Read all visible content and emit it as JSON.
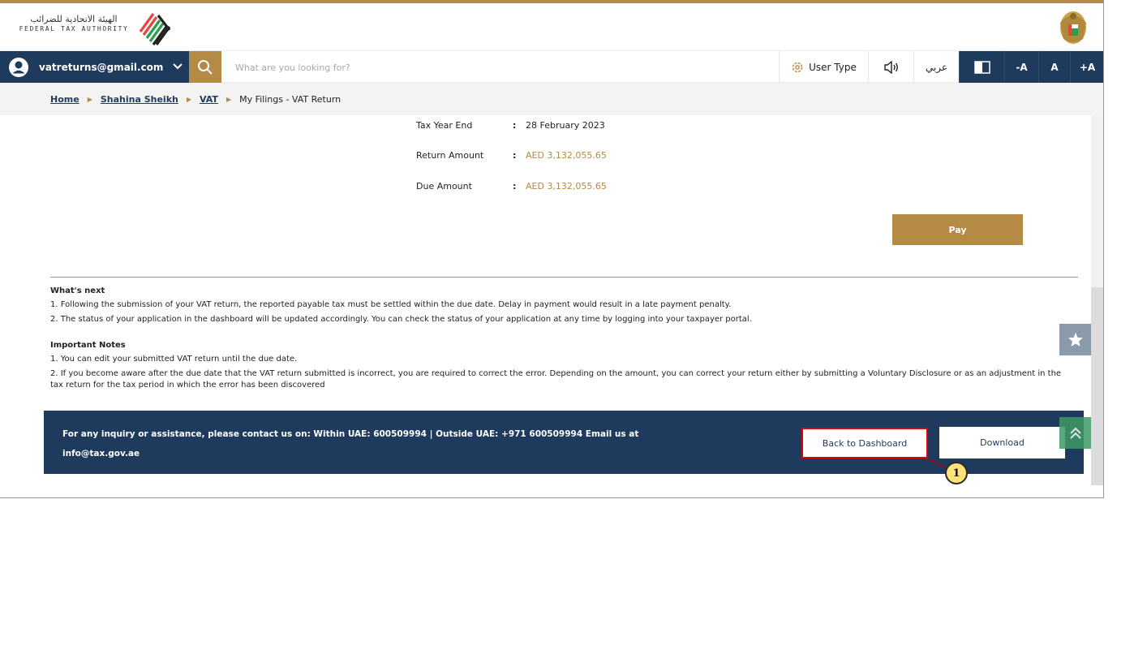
{
  "header": {
    "logo_ar": "الهيئة الاتحادية للضرائب",
    "logo_en": "FEDERAL TAX AUTHORITY"
  },
  "nav": {
    "user_email": "vatreturns@gmail.com",
    "search_placeholder": "What are you looking for?",
    "user_type_label": "User Type",
    "arabic_label": "عربي",
    "font_decrease": "-A",
    "font_normal": "A",
    "font_increase": "+A"
  },
  "breadcrumb": {
    "items": [
      "Home",
      "Shahina Sheikh",
      "VAT"
    ],
    "current": "My Filings - VAT Return"
  },
  "summary": {
    "rows": [
      {
        "label": "Tax Year End",
        "value": "28 February 2023"
      },
      {
        "label": "Return Amount",
        "value": "AED 3,132,055.65"
      },
      {
        "label": "Due Amount",
        "value": "AED 3,132,055.65"
      }
    ],
    "separator": ":",
    "amount_color": "#b48a45"
  },
  "pay_label": "Pay",
  "whats_next": {
    "title": "What's next",
    "items": [
      "1. Following the submission of your VAT return, the reported payable tax must be settled within the due date. Delay in payment would result in a late payment penalty.",
      "2. The status of your application in the dashboard will be updated accordingly. You can check the status of your application at any time by logging into your taxpayer portal."
    ]
  },
  "important_notes": {
    "title": "Important Notes",
    "items": [
      "1. You can edit your submitted VAT return until the due date.",
      "2. If you become aware after the due date that the VAT return submitted is incorrect, you are required to correct the error. Depending on the amount, you can correct your return either by submitting a Voluntary Disclosure or as an adjustment in the tax return for the tax period in which the error has been discovered"
    ]
  },
  "footer": {
    "contact_line1": "For any inquiry or assistance, please contact us on: Within UAE: 600509994 | Outside UAE: +971 600509994 Email us at",
    "contact_line2": "info@tax.gov.ae",
    "back_label": "Back to Dashboard",
    "download_label": "Download"
  },
  "callout_number": "1",
  "colors": {
    "brand_gold": "#b48a45",
    "navy": "#1e3a5c",
    "highlight_red": "#e00000"
  }
}
